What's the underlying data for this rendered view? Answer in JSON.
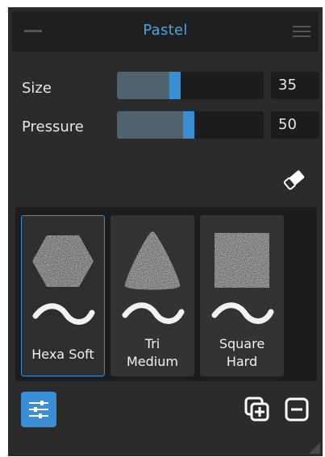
{
  "panel": {
    "title": "Pastel",
    "accent_color": "#3a8ed6",
    "title_color": "#4aa3df"
  },
  "controls": {
    "size": {
      "label": "Size",
      "value": "35",
      "level": 0.35
    },
    "pressure": {
      "label": "Pressure",
      "value": "50",
      "level": 0.5
    }
  },
  "icons": {
    "minimize": "minimize-icon",
    "menu": "hamburger-menu-icon",
    "eraser": "eraser-icon",
    "settings": "sliders-settings-icon",
    "duplicate": "duplicate-plus-icon",
    "remove": "remove-minus-icon",
    "resize": "resize-grip-icon"
  },
  "brushes": [
    {
      "name": "hexa-soft",
      "label_line1": "Hexa Soft",
      "label_line2": "",
      "shape": "hexagon",
      "selected": true
    },
    {
      "name": "tri-medium",
      "label_line1": "Tri",
      "label_line2": "Medium",
      "shape": "triangle",
      "selected": false
    },
    {
      "name": "square-hard",
      "label_line1": "Square",
      "label_line2": "Hard",
      "shape": "square",
      "selected": false
    }
  ]
}
